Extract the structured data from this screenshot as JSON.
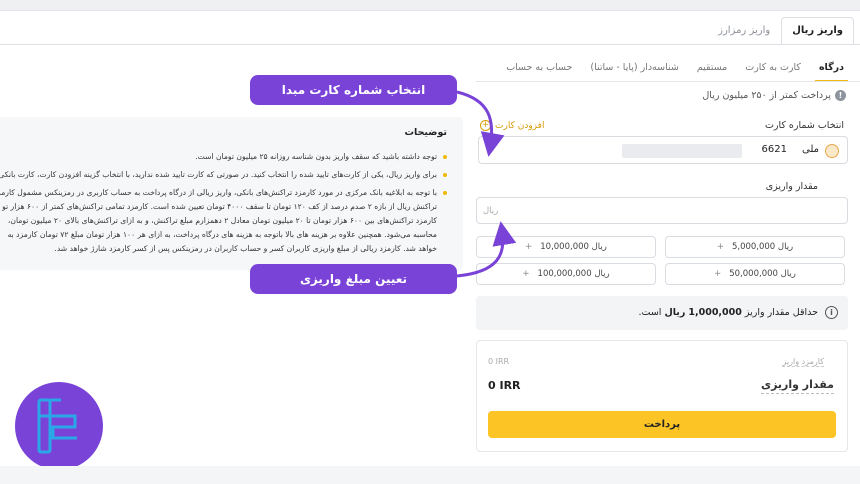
{
  "main_tabs": [
    {
      "label": "واریز ریال",
      "active": true
    },
    {
      "label": "واریز رمزارز",
      "active": false
    }
  ],
  "sub_tabs": [
    {
      "label": "درگاه",
      "active": true
    },
    {
      "label": "کارت به کارت",
      "active": false
    },
    {
      "label": "مستقیم",
      "active": false
    },
    {
      "label": "شناسه‌دار (پایا - ساتنا)",
      "active": false
    },
    {
      "label": "حساب به حساب",
      "active": false
    }
  ],
  "limit_note": "پرداخت کمتر از ۲۵۰ میلیون ریال",
  "card_select": {
    "label": "انتخاب شماره کارت",
    "add_card": "افزودن کارت",
    "bank_name": "ملی",
    "card_last_digits": "6621"
  },
  "amount": {
    "label": "مقدار واریزی",
    "placeholder": "ریال"
  },
  "presets": [
    {
      "value": "5,000,000",
      "unit": "ریال"
    },
    {
      "value": "10,000,000",
      "unit": "ریال"
    },
    {
      "value": "50,000,000",
      "unit": "ریال"
    },
    {
      "value": "100,000,000",
      "unit": "ریال"
    }
  ],
  "min_notice": {
    "prefix": "حداقل مقدار واریز",
    "amount": "1,000,000",
    "unit": "ریال",
    "suffix": "است."
  },
  "summary": {
    "fee_label": "کارمزد واریز",
    "fee_value": "0 IRR",
    "total_label": "مقدار واریزی",
    "total_value": "0 IRR",
    "pay_button": "پرداخت"
  },
  "description": {
    "title": "توضیحات",
    "items": [
      "توجه داشته باشید که سقف واریز بدون شناسه روزانه ۲۵ میلیون تومان است.",
      "برای واریز ریال، یکی از کارت‌های تایید شده را انتخاب کنید. در صورتی که کارت تایید شده ندارید، با انتخاب گزینه افزودن کارت، کارت بانکی",
      "با توجه به ابلاغیه بانک مرکزی در مورد کارمزد تراکنش‌های بانکی، واریز ریالی از درگاه پرداخت به حساب کاربری در رمزینکس مشمول کارمزد"
    ],
    "item3_lines": [
      "تراکنش ریال از بازه ۲ صدم درصد از کف ۱۲۰ تومان تا سقف ۴۰۰۰ تومان تعیین شده است. کارمزد تمامی تراکنش‌های کمتر از ۶۰۰ هزار تو",
      "کارمزد تراکنش‌های بین ۶۰۰ هزار تومان تا ۲۰ میلیون تومان معادل ۲ دهمزارم مبلغ تراکنش، و به ازای تراکنش‌های بالای ۲۰ میلیون تومان،",
      "محاسبه می‌شود. همچنین علاوه بر هزینه های بالا باتوجه به هزینه های درگاه پرداخت، به ازای هر ۱۰۰ هزار تومان مبلغ ۷۲ تومان کارمزد به",
      "خواهد شد. کارمزد ریالی از مبلغ واریزی کاربران کسر و حساب کاربران در رمزینکس پس از کسر کارمزد شارژ خواهد شد."
    ]
  },
  "callouts": {
    "select_card": "انتخاب شماره کارت مبدا",
    "set_amount": "تعیین مبلغ واریزی"
  },
  "colors": {
    "accent": "#f0b90b",
    "pay_button": "#fcc424",
    "callout": "#7a43d8"
  }
}
